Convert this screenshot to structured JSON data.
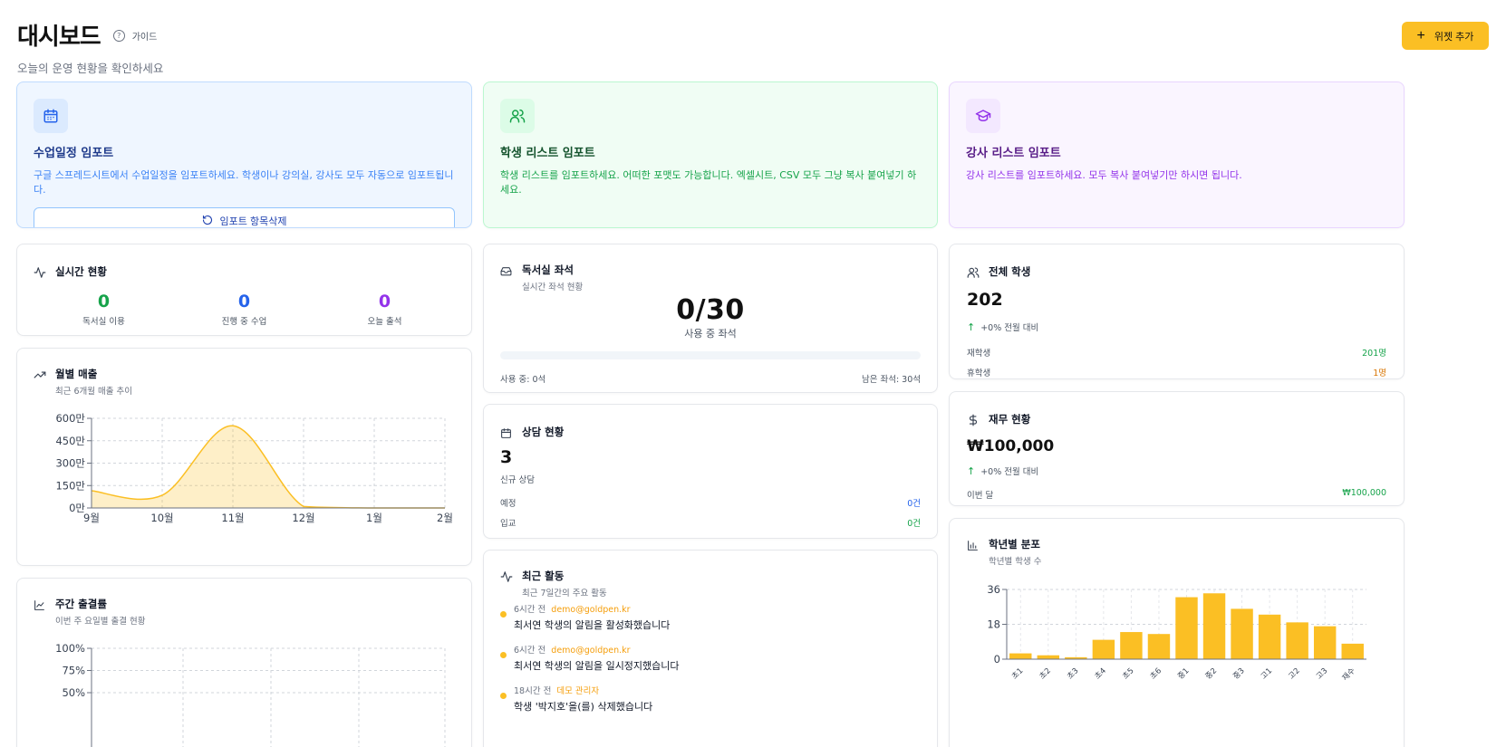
{
  "header": {
    "title": "대시보드",
    "guide_label": "가이드",
    "subtitle": "오늘의 운영 현황을 확인하세요",
    "add_widget_label": "위젯 추가"
  },
  "imports": {
    "schedule": {
      "title": "수업일정 임포트",
      "description": "구글 스프레드시트에서 수업일정을 임포트하세요. 학생이나 강의실, 강사도 모두 자동으로 임포트됩니다.",
      "button_label": "임포트 항목삭제"
    },
    "students": {
      "title": "학생 리스트 임포트",
      "description": "학생 리스트를 임포트하세요. 어떠한 포맷도 가능합니다. 엑셀시트, CSV 모두 그냥 복사 붙여넣기 하세요."
    },
    "instructors": {
      "title": "강사 리스트 임포트",
      "description": "강사 리스트를 임포트하세요. 모두 복사 붙여넣기만 하시면 됩니다."
    }
  },
  "realtime": {
    "title": "실시간 현황",
    "stats": [
      {
        "value": "0",
        "label": "독서실 이용",
        "color": "#16a34a"
      },
      {
        "value": "0",
        "label": "진행 중 수업",
        "color": "#2563eb"
      },
      {
        "value": "0",
        "label": "오늘 출석",
        "color": "#9333ea"
      }
    ]
  },
  "study_room": {
    "title": "독서실 좌석",
    "subtitle": "실시간 좌석 현황",
    "count": "0/30",
    "count_label": "사용 중 좌석",
    "used_label": "사용 중: 0석",
    "remaining_label": "남은 좌석: 30석",
    "occupancy": 0
  },
  "total_students": {
    "title": "전체 학생",
    "value": "202",
    "trend": "+0% 전월 대비",
    "rows": [
      {
        "label": "재학생",
        "value": "201명",
        "color": "#16a34a"
      },
      {
        "label": "휴학생",
        "value": "1명",
        "color": "#d97706"
      }
    ]
  },
  "monthly_revenue": {
    "title": "월별 매출",
    "subtitle": "최근 6개월 매출 추이"
  },
  "consultation": {
    "title": "상담 현황",
    "value": "3",
    "label": "신규 상담",
    "rows": [
      {
        "label": "예정",
        "value": "0건",
        "color": "#2563eb"
      },
      {
        "label": "입교",
        "value": "0건",
        "color": "#16a34a"
      }
    ]
  },
  "finance": {
    "title": "재무 현황",
    "value": "₩100,000",
    "trend": "+0% 전월 대비",
    "row": {
      "label": "이번 달",
      "value": "₩100,000",
      "color": "#16a34a"
    }
  },
  "weekly_attendance": {
    "title": "주간 출결률",
    "subtitle": "이번 주 요일별 출결 현황"
  },
  "recent_activity": {
    "title": "최근 활동",
    "subtitle": "최근 7일간의 주요 활동",
    "items": [
      {
        "time": "6시간 전",
        "user": "demo@goldpen.kr",
        "text": "최서연 학생의 알림을 활성화했습니다"
      },
      {
        "time": "6시간 전",
        "user": "demo@goldpen.kr",
        "text": "최서연 학생의 알림을 일시정지했습니다"
      },
      {
        "time": "18시간 전",
        "user": "데모 관리자",
        "text": "학생 '박지호'을(를) 삭제했습니다"
      }
    ]
  },
  "grade_distribution": {
    "title": "학년별 분포",
    "subtitle": "학년별 학생 수"
  },
  "chart_data": [
    {
      "type": "area",
      "categories": [
        "9월",
        "10월",
        "11월",
        "12월",
        "1월",
        "2월"
      ],
      "values": [
        1150000,
        850000,
        5500000,
        100000,
        0,
        0
      ],
      "ytick_labels": [
        "600만",
        "450만",
        "300만",
        "150만",
        "0만"
      ],
      "ylim": [
        0,
        6000000
      ],
      "grid": true,
      "color": "#fbbf24"
    },
    {
      "type": "line",
      "ytick_labels": [
        "100%",
        "75%",
        "50%"
      ],
      "ylim": [
        0,
        100
      ],
      "grid": true
    },
    {
      "type": "bar",
      "categories": [
        "초1",
        "초2",
        "초3",
        "초4",
        "초5",
        "초6",
        "중1",
        "중2",
        "중3",
        "고1",
        "고2",
        "고3",
        "재수"
      ],
      "values": [
        3,
        2,
        1,
        10,
        14,
        13,
        32,
        34,
        26,
        23,
        19,
        17,
        8
      ],
      "yticks": [
        0,
        18,
        36
      ],
      "ylim": [
        0,
        36
      ],
      "grid": true,
      "color": "#fbbf24"
    }
  ]
}
